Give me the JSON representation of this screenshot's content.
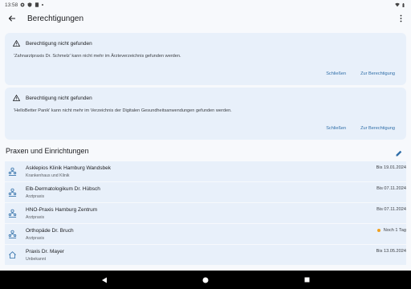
{
  "status_bar": {
    "time": "13:58"
  },
  "app_bar": {
    "title": "Berechtigungen"
  },
  "alerts": [
    {
      "title": "Berechtigung nicht gefunden",
      "message": "'Zahnarztpraxis Dr. Schmelz' kann nicht mehr im Ärzteverzeichnis gefunden werden.",
      "dismiss_label": "Schließen",
      "action_label": "Zur Berechtigung"
    },
    {
      "title": "Berechtigung nicht gefunden",
      "message": "'HelloBetter Panik' kann nicht mehr im Verzeichnis der Digitalen Gesundheitsanwendungen gefunden werden.",
      "dismiss_label": "Schließen",
      "action_label": "Zur Berechtigung"
    }
  ],
  "section": {
    "title": "Praxen und Einrichtungen"
  },
  "entries": [
    {
      "name": "Asklepios Klinik Hamburg Wandsbek",
      "type": "Krankenhaus und Klinik",
      "date": "Bis 19.01.2024",
      "icon": "people-icon"
    },
    {
      "name": "Elb-Dermatologikum Dr. Hübsch",
      "type": "Arztpraxis",
      "date": "Bis 07.11.2024",
      "icon": "people-icon"
    },
    {
      "name": "HNO-Praxis Hamburg Zentrum",
      "type": "Arztpraxis",
      "date": "Bis 07.11.2024",
      "icon": "people-icon"
    },
    {
      "name": "Orthopäde Dr. Bruch",
      "type": "Arztpraxis",
      "date": "Noch 1 Tag",
      "icon": "people-icon",
      "warning": true
    },
    {
      "name": "Praxis Dr. Mayer",
      "type": "Unbekannt",
      "date": "Bis 13.05.2024",
      "icon": "home-icon"
    }
  ],
  "colors": {
    "accent": "#2f6ea8",
    "card_bg": "#e8f0fa",
    "warning_dot": "#f0a020"
  }
}
